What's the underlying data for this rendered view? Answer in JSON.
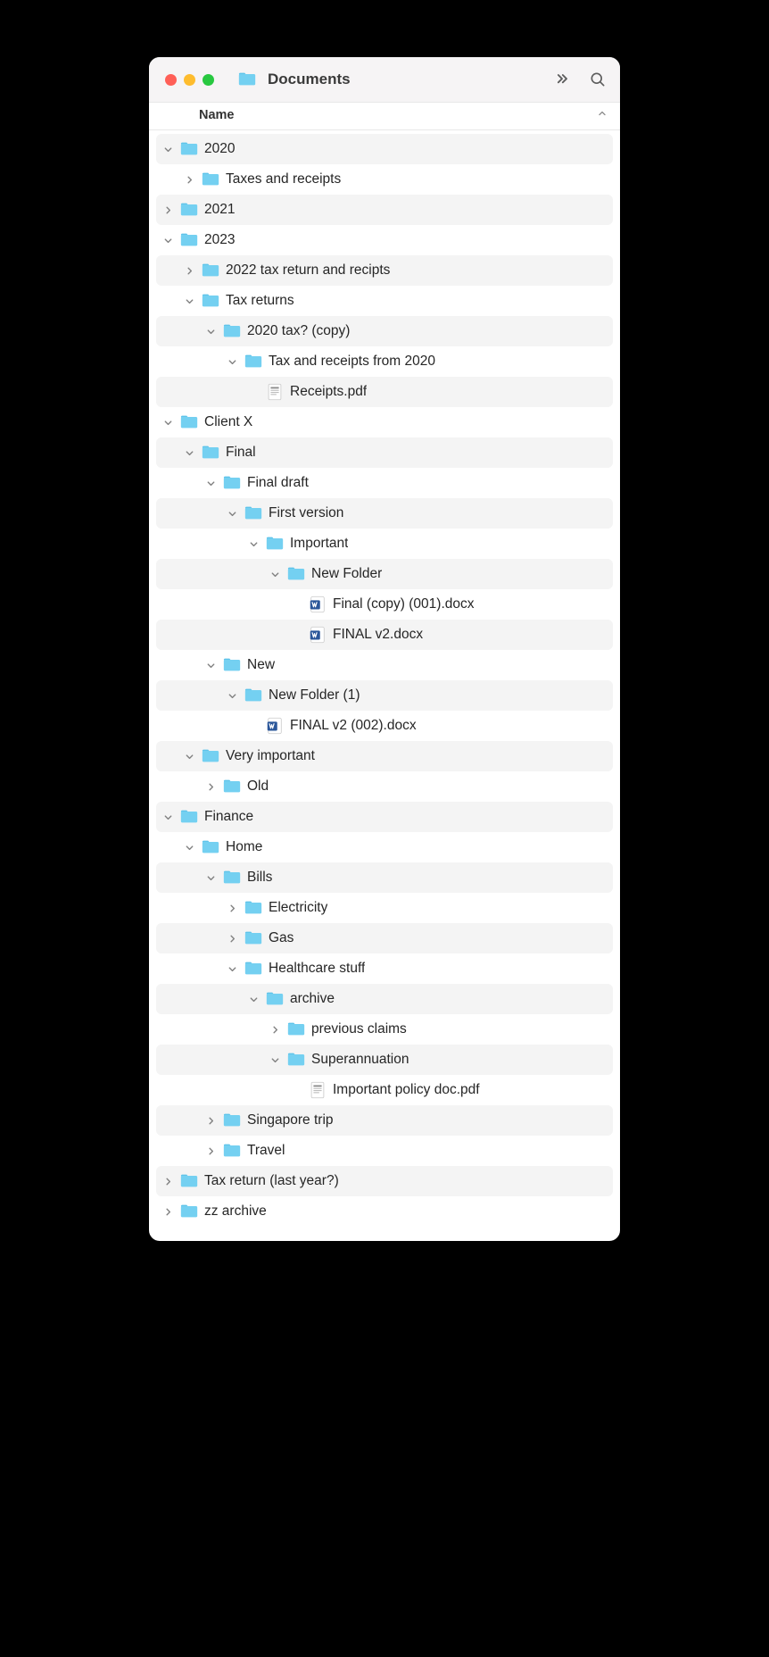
{
  "window": {
    "title": "Documents",
    "columnHeader": "Name"
  },
  "tree": [
    {
      "depth": 0,
      "expanded": true,
      "type": "folder",
      "label": "2020"
    },
    {
      "depth": 1,
      "expanded": false,
      "type": "folder",
      "label": "Taxes and receipts"
    },
    {
      "depth": 0,
      "expanded": false,
      "type": "folder",
      "label": "2021"
    },
    {
      "depth": 0,
      "expanded": true,
      "type": "folder",
      "label": "2023"
    },
    {
      "depth": 1,
      "expanded": false,
      "type": "folder",
      "label": "2022 tax return and recipts"
    },
    {
      "depth": 1,
      "expanded": true,
      "type": "folder",
      "label": "Tax returns"
    },
    {
      "depth": 2,
      "expanded": true,
      "type": "folder",
      "label": "2020 tax? (copy)"
    },
    {
      "depth": 3,
      "expanded": true,
      "type": "folder",
      "label": "Tax and receipts from 2020"
    },
    {
      "depth": 4,
      "expanded": null,
      "type": "pdf",
      "label": "Receipts.pdf"
    },
    {
      "depth": 0,
      "expanded": true,
      "type": "folder",
      "label": "Client X"
    },
    {
      "depth": 1,
      "expanded": true,
      "type": "folder",
      "label": "Final"
    },
    {
      "depth": 2,
      "expanded": true,
      "type": "folder",
      "label": "Final draft"
    },
    {
      "depth": 3,
      "expanded": true,
      "type": "folder",
      "label": "First version"
    },
    {
      "depth": 4,
      "expanded": true,
      "type": "folder",
      "label": "Important"
    },
    {
      "depth": 5,
      "expanded": true,
      "type": "folder",
      "label": "New Folder"
    },
    {
      "depth": 6,
      "expanded": null,
      "type": "docx",
      "label": "Final (copy) (001).docx"
    },
    {
      "depth": 6,
      "expanded": null,
      "type": "docx",
      "label": "FINAL v2.docx"
    },
    {
      "depth": 2,
      "expanded": true,
      "type": "folder",
      "label": "New"
    },
    {
      "depth": 3,
      "expanded": true,
      "type": "folder",
      "label": "New Folder (1)"
    },
    {
      "depth": 4,
      "expanded": null,
      "type": "docx",
      "label": "FINAL v2 (002).docx"
    },
    {
      "depth": 1,
      "expanded": true,
      "type": "folder",
      "label": "Very important"
    },
    {
      "depth": 2,
      "expanded": false,
      "type": "folder",
      "label": "Old"
    },
    {
      "depth": 0,
      "expanded": true,
      "type": "folder",
      "label": "Finance"
    },
    {
      "depth": 1,
      "expanded": true,
      "type": "folder",
      "label": "Home"
    },
    {
      "depth": 2,
      "expanded": true,
      "type": "folder",
      "label": "Bills"
    },
    {
      "depth": 3,
      "expanded": false,
      "type": "folder",
      "label": "Electricity"
    },
    {
      "depth": 3,
      "expanded": false,
      "type": "folder",
      "label": "Gas"
    },
    {
      "depth": 3,
      "expanded": true,
      "type": "folder",
      "label": "Healthcare stuff"
    },
    {
      "depth": 4,
      "expanded": true,
      "type": "folder",
      "label": "archive"
    },
    {
      "depth": 5,
      "expanded": false,
      "type": "folder",
      "label": "previous claims"
    },
    {
      "depth": 5,
      "expanded": true,
      "type": "folder",
      "label": "Superannuation"
    },
    {
      "depth": 6,
      "expanded": null,
      "type": "pdf",
      "label": "Important policy doc.pdf"
    },
    {
      "depth": 2,
      "expanded": false,
      "type": "folder",
      "label": "Singapore trip"
    },
    {
      "depth": 2,
      "expanded": false,
      "type": "folder",
      "label": "Travel"
    },
    {
      "depth": 0,
      "expanded": false,
      "type": "folder",
      "label": "Tax return (last year?)"
    },
    {
      "depth": 0,
      "expanded": false,
      "type": "folder",
      "label": "zz archive"
    }
  ]
}
